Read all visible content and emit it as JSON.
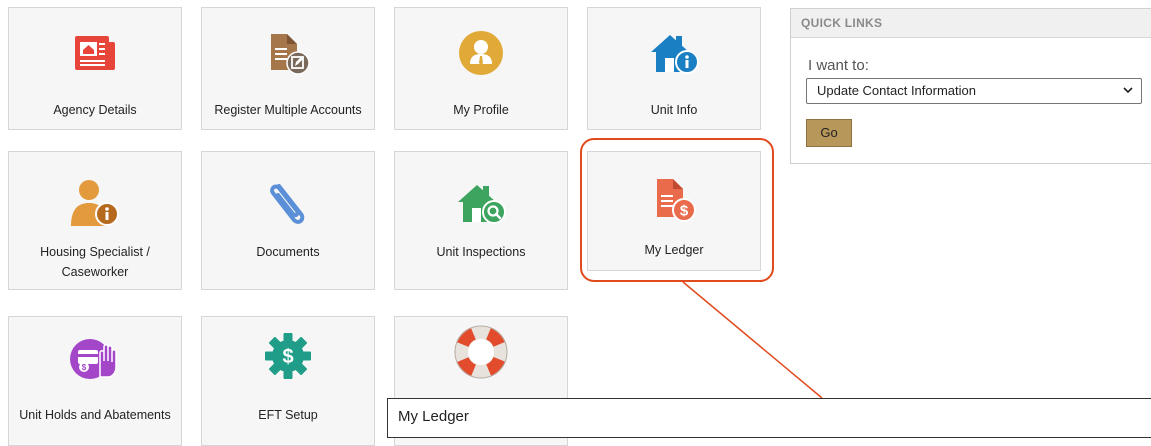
{
  "tiles": [
    {
      "label": "Agency Details"
    },
    {
      "label": "Register Multiple Accounts"
    },
    {
      "label": "My Profile"
    },
    {
      "label": "Unit Info"
    },
    {
      "label": "Housing Specialist / Caseworker"
    },
    {
      "label": "Documents"
    },
    {
      "label": "Unit Inspections"
    },
    {
      "label": "My Ledger"
    },
    {
      "label": "Unit Holds and Abatements"
    },
    {
      "label": "EFT Setup"
    },
    {
      "label": ""
    }
  ],
  "quick_links": {
    "title": "QUICK LINKS",
    "prompt": "I want to:",
    "selected": "Update Contact Information",
    "go_label": "Go"
  },
  "tooltip": "My Ledger",
  "colors": {
    "agency_red": "#e8453a",
    "doc_brown": "#a5764a",
    "profile_gold": "#e0a938",
    "unit_blue": "#1b7fc3",
    "specialist_orange": "#e39a3d",
    "clip_blue": "#5b8fd8",
    "inspection_green": "#3ca45e",
    "ledger_coral": "#e96b4c",
    "holds_purple": "#a347c8",
    "eft_teal": "#1f9d88",
    "go_button": "#b8975a",
    "highlight": "#e04a1c"
  }
}
